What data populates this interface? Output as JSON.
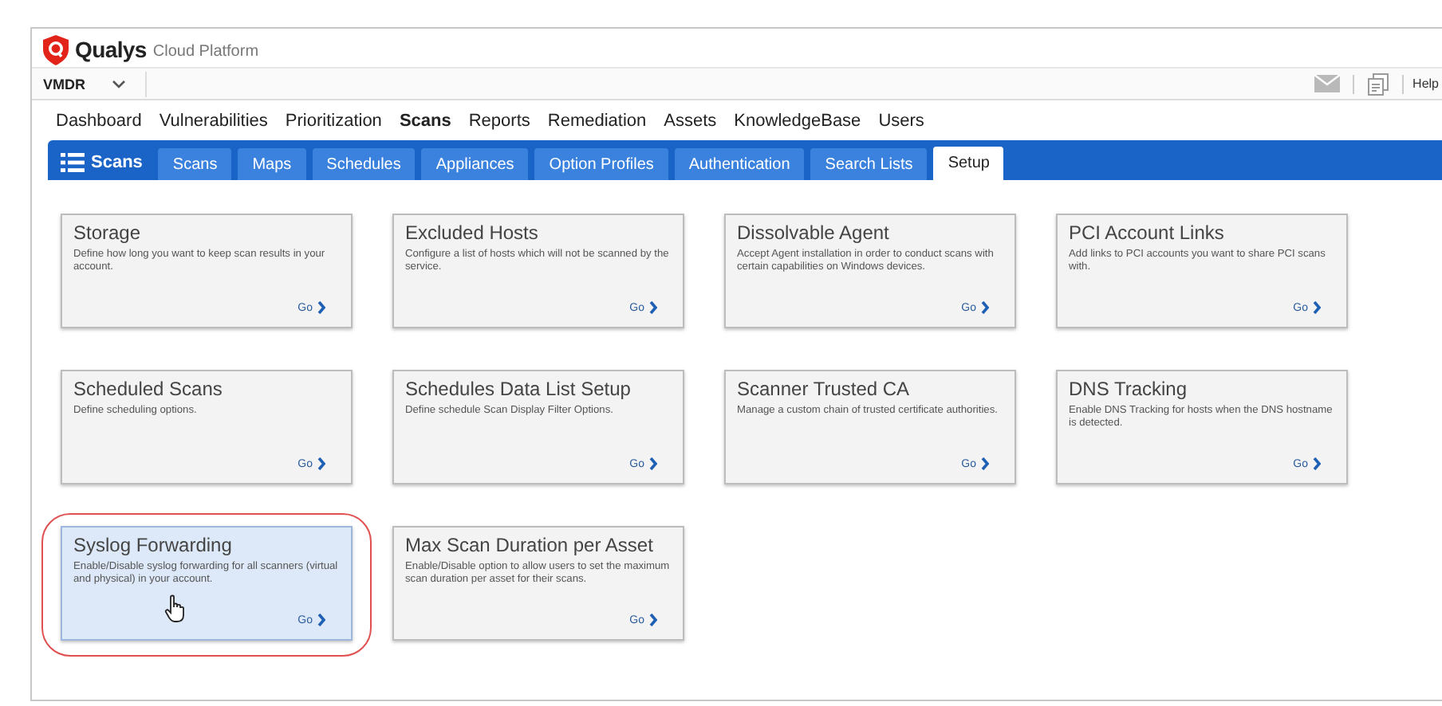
{
  "brand": {
    "name": "Qualys",
    "product": "Cloud Platform"
  },
  "module_selector": {
    "value": "VMDR"
  },
  "top_right": {
    "help": "Help"
  },
  "main_nav": [
    {
      "label": "Dashboard",
      "selected": false
    },
    {
      "label": "Vulnerabilities",
      "selected": false
    },
    {
      "label": "Prioritization",
      "selected": false
    },
    {
      "label": "Scans",
      "selected": true
    },
    {
      "label": "Reports",
      "selected": false
    },
    {
      "label": "Remediation",
      "selected": false
    },
    {
      "label": "Assets",
      "selected": false
    },
    {
      "label": "KnowledgeBase",
      "selected": false
    },
    {
      "label": "Users",
      "selected": false
    }
  ],
  "section_title": "Scans",
  "tabs": [
    {
      "label": "Scans",
      "selected": false
    },
    {
      "label": "Maps",
      "selected": false
    },
    {
      "label": "Schedules",
      "selected": false
    },
    {
      "label": "Appliances",
      "selected": false
    },
    {
      "label": "Option Profiles",
      "selected": false
    },
    {
      "label": "Authentication",
      "selected": false
    },
    {
      "label": "Search Lists",
      "selected": false
    },
    {
      "label": "Setup",
      "selected": true
    }
  ],
  "cards": [
    {
      "title": "Storage",
      "description": "Define how long you want to keep scan results in your account.",
      "link": "Go",
      "highlighted": false
    },
    {
      "title": "Excluded Hosts",
      "description": "Configure a list of hosts which will not be scanned by the service.",
      "link": "Go",
      "highlighted": false
    },
    {
      "title": "Dissolvable Agent",
      "description": "Accept Agent installation in order to conduct scans with certain capabilities on Windows devices.",
      "link": "Go",
      "highlighted": false
    },
    {
      "title": "PCI Account Links",
      "description": "Add links to PCI accounts you want to share PCI scans with.",
      "link": "Go",
      "highlighted": false
    },
    {
      "title": "Scheduled Scans",
      "description": "Define scheduling options.",
      "link": "Go",
      "highlighted": false
    },
    {
      "title": "Schedules Data List Setup",
      "description": "Define schedule Scan Display Filter Options.",
      "link": "Go",
      "highlighted": false
    },
    {
      "title": "Scanner Trusted CA",
      "description": "Manage a custom chain of trusted certificate authorities.",
      "link": "Go",
      "highlighted": false
    },
    {
      "title": "DNS Tracking",
      "description": "Enable DNS Tracking for hosts when the DNS hostname is detected.",
      "link": "Go",
      "highlighted": false
    },
    {
      "title": "Syslog Forwarding",
      "description": "Enable/Disable syslog forwarding for all scanners (virtual and physical) in your account.",
      "link": "Go",
      "highlighted": true
    },
    {
      "title": "Max Scan Duration per Asset",
      "description": "Enable/Disable option to allow users to set the maximum scan duration per asset for their scans.",
      "link": "Go",
      "highlighted": false
    }
  ]
}
